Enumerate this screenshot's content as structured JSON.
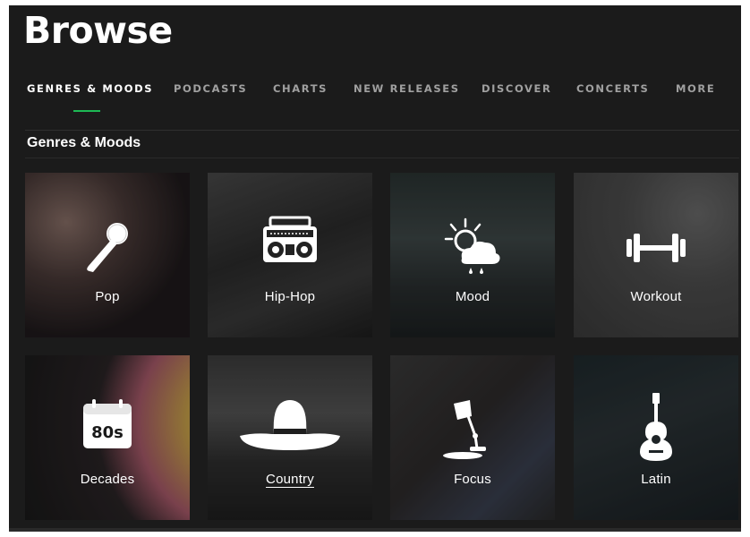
{
  "page": {
    "title": "Browse"
  },
  "tabs": [
    {
      "label": "GENRES & MOODS",
      "active": true
    },
    {
      "label": "PODCASTS"
    },
    {
      "label": "CHARTS"
    },
    {
      "label": "NEW RELEASES"
    },
    {
      "label": "DISCOVER"
    },
    {
      "label": "CONCERTS"
    },
    {
      "label": "MORE"
    }
  ],
  "section": {
    "title": "Genres & Moods"
  },
  "tiles": [
    {
      "label": "Pop",
      "icon": "microphone-icon"
    },
    {
      "label": "Hip-Hop",
      "icon": "boombox-icon"
    },
    {
      "label": "Mood",
      "icon": "weather-icon"
    },
    {
      "label": "Workout",
      "icon": "dumbbell-icon"
    },
    {
      "label": "Decades",
      "icon": "calendar-80s-icon",
      "badge": "80s"
    },
    {
      "label": "Country",
      "icon": "cowboy-hat-icon"
    },
    {
      "label": "Focus",
      "icon": "desk-lamp-icon"
    },
    {
      "label": "Latin",
      "icon": "guitar-icon"
    }
  ],
  "colors": {
    "accent": "#1db954",
    "background": "#1b1b1b",
    "text": "#ffffff",
    "muted": "#a0a0a0"
  }
}
